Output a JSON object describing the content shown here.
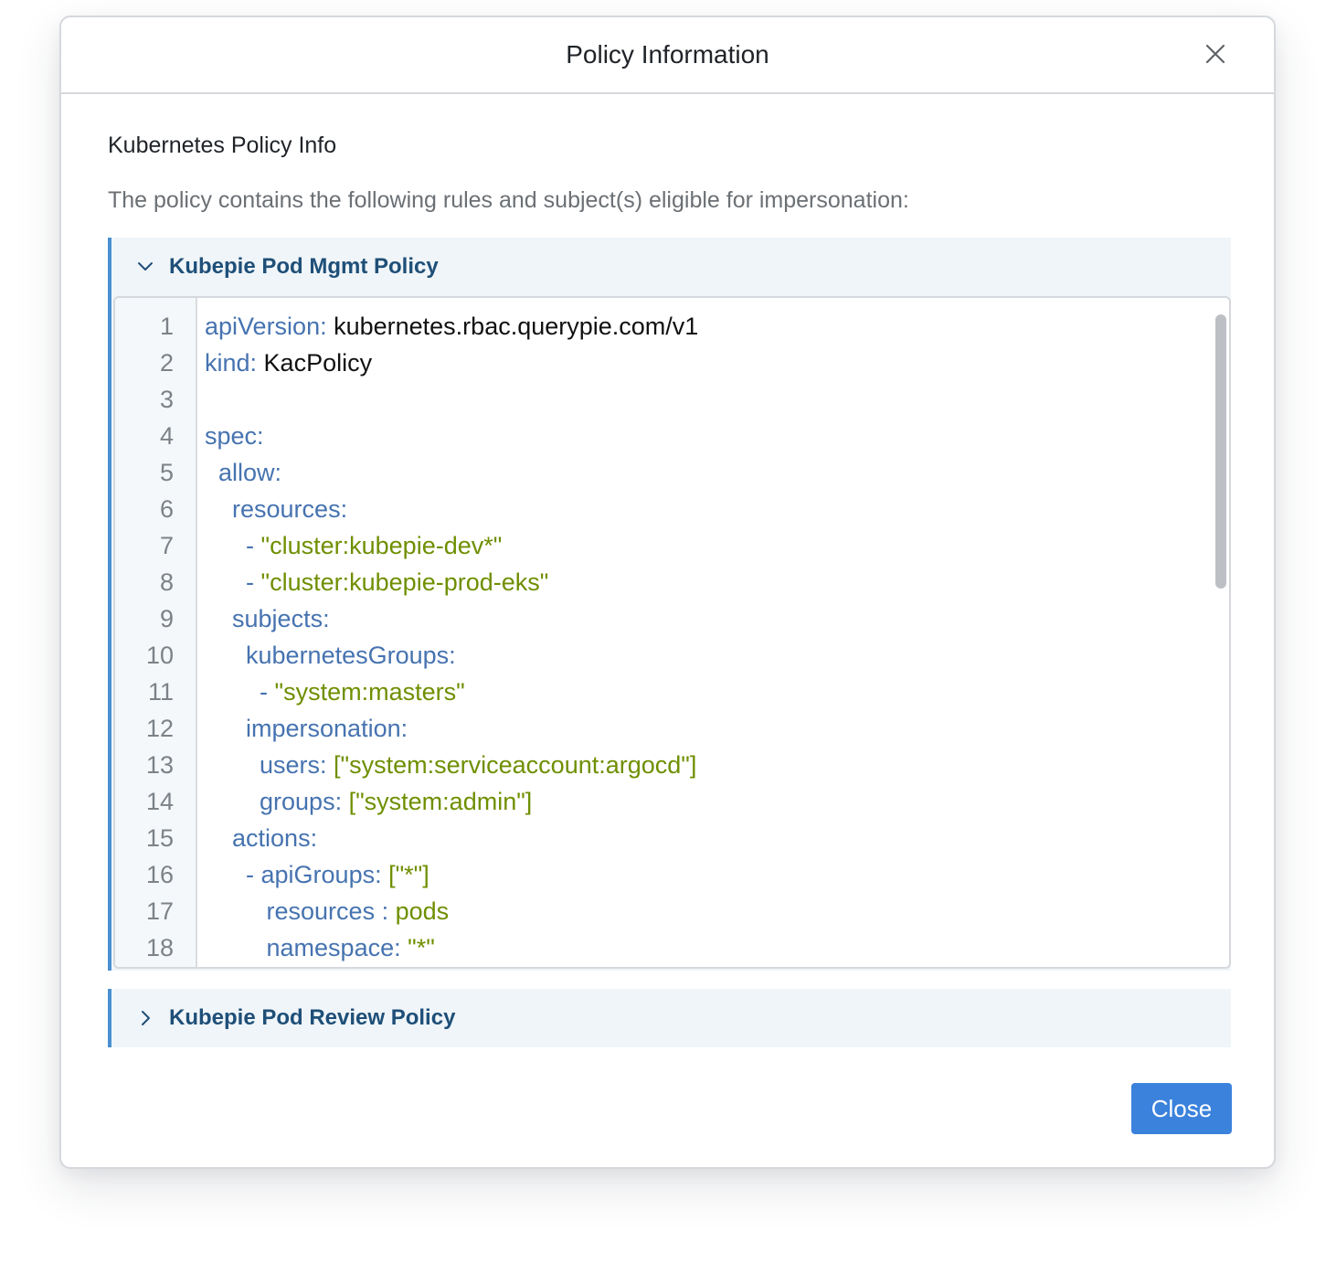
{
  "modal": {
    "title": "Policy Information",
    "close_icon": "close-x-icon"
  },
  "section": {
    "title": "Kubernetes Policy Info",
    "description": "The policy contains the following rules and subject(s) eligible for impersonation:"
  },
  "policies": [
    {
      "name": "Kubepie Pod Mgmt Policy",
      "expanded": true,
      "icon": "chevron-down-icon",
      "code_lines": [
        {
          "num": "1",
          "indent": "",
          "key": "apiVersion:",
          "value": " kubernetes.rbac.querypie.com/v1",
          "value_type": "plain"
        },
        {
          "num": "2",
          "indent": "",
          "key": "kind:",
          "value": " KacPolicy",
          "value_type": "plain"
        },
        {
          "num": "3",
          "indent": "",
          "key": "",
          "value": "",
          "value_type": "plain"
        },
        {
          "num": "4",
          "indent": "",
          "key": "spec:",
          "value": "",
          "value_type": "plain"
        },
        {
          "num": "5",
          "indent": "  ",
          "key": "allow:",
          "value": "",
          "value_type": "plain"
        },
        {
          "num": "6",
          "indent": "    ",
          "key": "resources:",
          "value": "",
          "value_type": "plain"
        },
        {
          "num": "7",
          "indent": "      ",
          "key": "- ",
          "value": "\"cluster:kubepie-dev*\"",
          "value_type": "string"
        },
        {
          "num": "8",
          "indent": "      ",
          "key": "- ",
          "value": "\"cluster:kubepie-prod-eks\"",
          "value_type": "string"
        },
        {
          "num": "9",
          "indent": "    ",
          "key": "subjects:",
          "value": "",
          "value_type": "plain"
        },
        {
          "num": "10",
          "indent": "      ",
          "key": "kubernetesGroups:",
          "value": "",
          "value_type": "plain"
        },
        {
          "num": "11",
          "indent": "        ",
          "key": "- ",
          "value": "\"system:masters\"",
          "value_type": "string"
        },
        {
          "num": "12",
          "indent": "      ",
          "key": "impersonation:",
          "value": "",
          "value_type": "plain"
        },
        {
          "num": "13",
          "indent": "        ",
          "key": "users: ",
          "value": "[\"system:serviceaccount:argocd\"]",
          "value_type": "string"
        },
        {
          "num": "14",
          "indent": "        ",
          "key": "groups: ",
          "value": "[\"system:admin\"]",
          "value_type": "string"
        },
        {
          "num": "15",
          "indent": "    ",
          "key": "actions:",
          "value": "",
          "value_type": "plain"
        },
        {
          "num": "16",
          "indent": "      ",
          "key": "- apiGroups: ",
          "value": "[\"*\"]",
          "value_type": "string"
        },
        {
          "num": "17",
          "indent": "         ",
          "key": "resources : ",
          "value": "pods",
          "value_type": "string"
        },
        {
          "num": "18",
          "indent": "         ",
          "key": "namespace: ",
          "value": "\"*\"",
          "value_type": "string"
        }
      ]
    },
    {
      "name": "Kubepie Pod Review Policy",
      "expanded": false,
      "icon": "chevron-right-icon"
    }
  ],
  "footer": {
    "close_label": "Close"
  },
  "colors": {
    "accent": "#3b82dc",
    "accordion_border": "#4a8fd1",
    "accordion_bg": "#f0f5f9",
    "accordion_title": "#1e4f78",
    "yaml_key": "#4673b0",
    "yaml_string": "#6f8f00"
  }
}
